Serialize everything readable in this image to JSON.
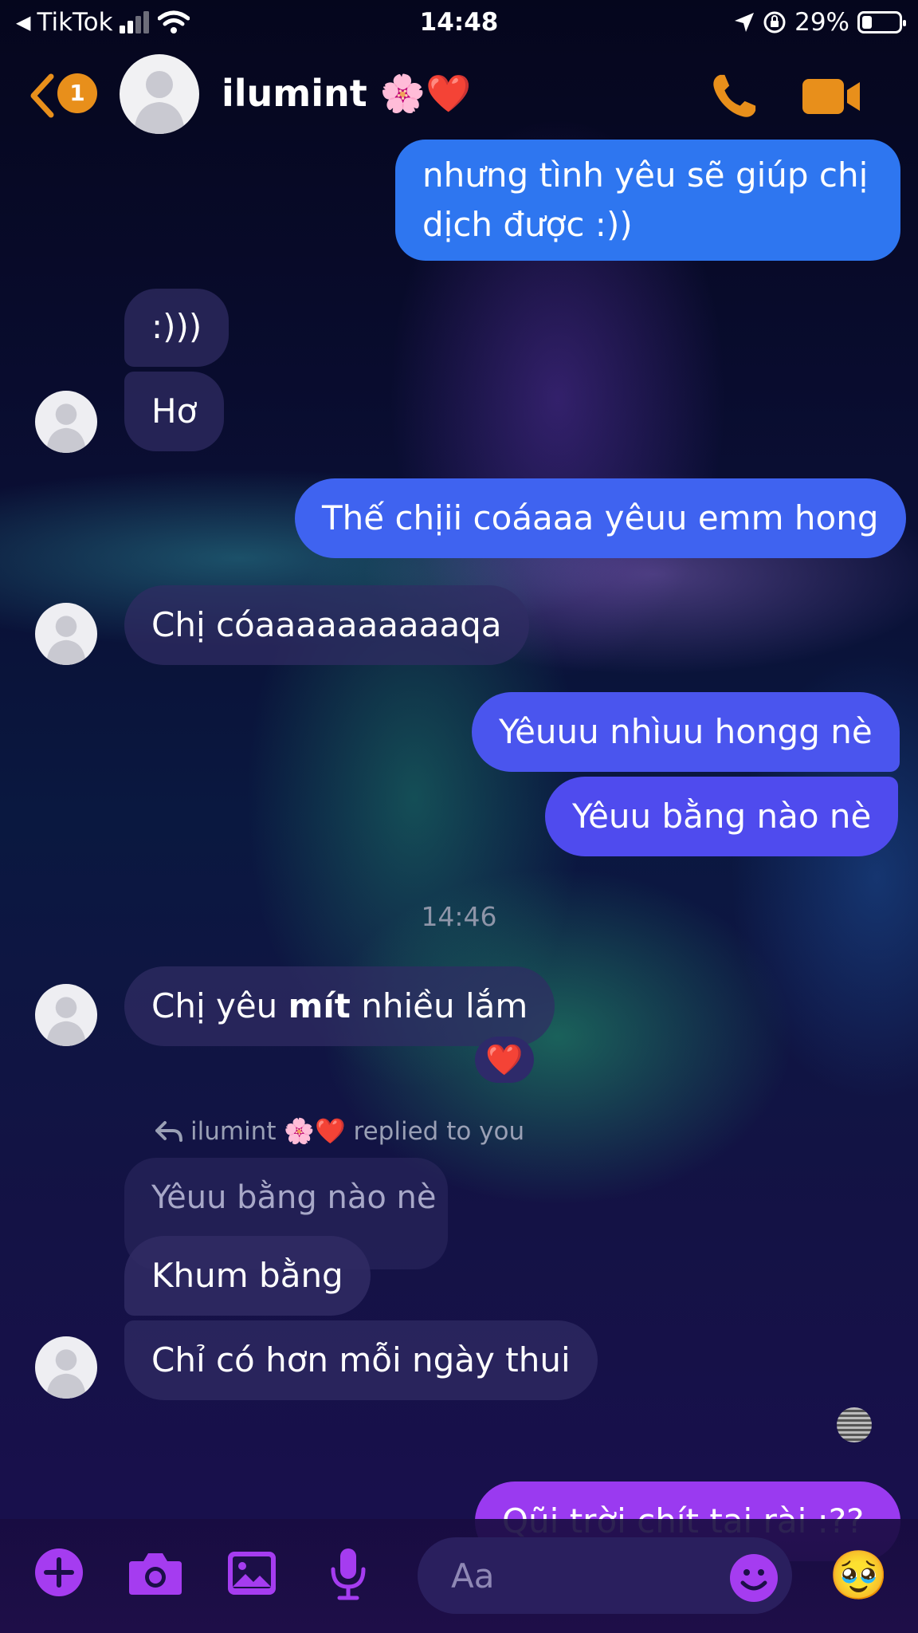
{
  "status_bar": {
    "back_app": "TikTok",
    "time": "14:48",
    "battery": "29%"
  },
  "header": {
    "unread_count": "1",
    "contact_name": "ilumint 🌸❤️"
  },
  "messages": {
    "m1": "nhưng tình yêu sẽ giúp chị",
    "m1b": "dịch được :))",
    "m2": ":)))",
    "m3": "Hơ",
    "m4": "Thế chịii coáaaa yêuu emm hong",
    "m5": "Chị cóaaaaaaaaaaqa",
    "m6": "Yêuuu nhìuu hongg nè",
    "m7": "Yêuu bằng nào nè",
    "timestamp": "14:46",
    "m8_pre": "Chị yêu ",
    "m8_bold": "mít",
    "m8_post": " nhiều lắm",
    "reaction": "❤️",
    "reply_note_name": "ilumint 🌸❤️",
    "reply_note_suffix": "replied to you",
    "quoted": "Yêuu bằng nào nè",
    "m9": "Khum bằng",
    "m10": "Chỉ có hơn mỗi ngày thui",
    "m11_partial": "Qũi trời chít tai rài :??"
  },
  "composer": {
    "placeholder": "Aa",
    "quick_emoji": "🥹"
  },
  "colors": {
    "accent": "#e88f1b",
    "toolbar_purple": "#a53cf0",
    "out_blue": "#2e76f0",
    "out_indigo": "#4a55ee",
    "out_violet": "#9a3af0"
  }
}
